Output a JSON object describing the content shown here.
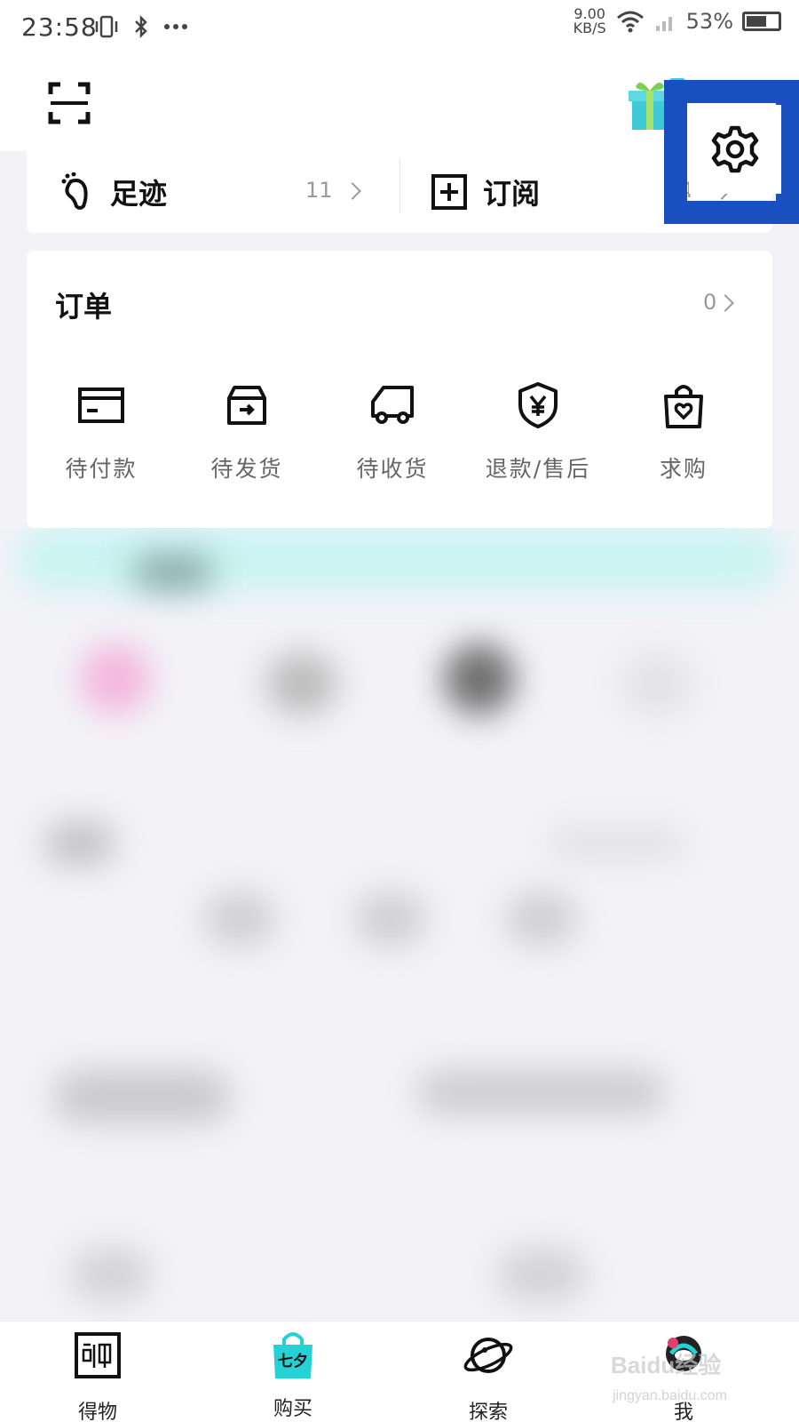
{
  "status_bar": {
    "time": "23:58",
    "net_speed_value": "9.00",
    "net_speed_unit": "KB/S",
    "battery": "53%"
  },
  "header": {
    "scan_icon": "scan-icon",
    "gift_icon": "gift-icon",
    "settings_icon": "gear-icon",
    "highlight_color": "#1a4fbf"
  },
  "quick_links": [
    {
      "label": "足迹",
      "count": "11",
      "icon": "footprint-icon"
    },
    {
      "label": "订阅",
      "count": "4",
      "icon": "plus-square-icon"
    }
  ],
  "orders": {
    "title": "订单",
    "count": "0",
    "items": [
      {
        "label": "待付款",
        "icon": "card-icon"
      },
      {
        "label": "待发货",
        "icon": "box-icon"
      },
      {
        "label": "待收货",
        "icon": "truck-icon"
      },
      {
        "label": "退款/售后",
        "icon": "yen-shield-icon"
      },
      {
        "label": "求购",
        "icon": "heart-bag-icon"
      }
    ]
  },
  "bottom_nav": [
    {
      "label": "得物",
      "icon": "dewu-icon"
    },
    {
      "label": "购买",
      "icon": "shopping-bag-icon",
      "badge": "七夕"
    },
    {
      "label": "探索",
      "icon": "planet-icon"
    },
    {
      "label": "我",
      "icon": "avatar-icon"
    }
  ],
  "watermark": {
    "text": "Baidu经验",
    "sub": "jingyan.baidu.com"
  },
  "colors": {
    "accent_cyan": "#26d1d6",
    "text_gray": "#666666"
  }
}
